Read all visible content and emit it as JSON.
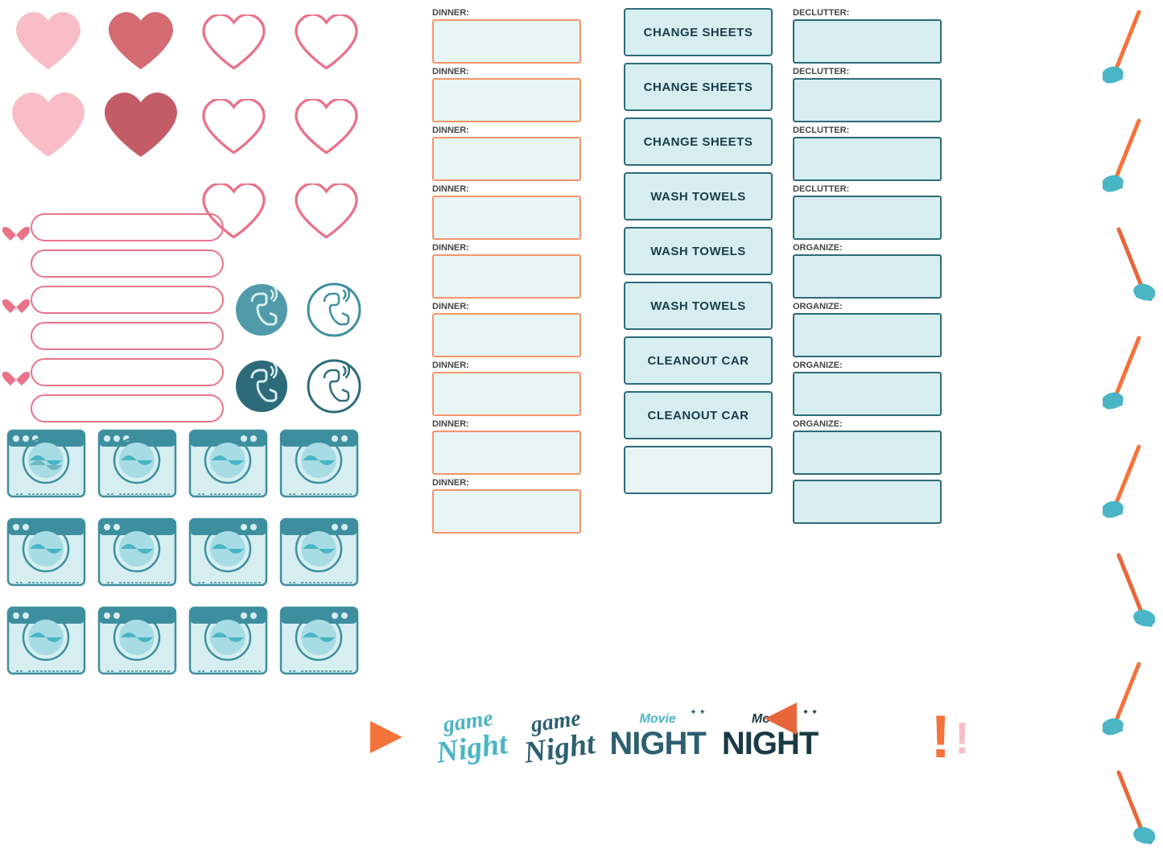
{
  "hearts": {
    "row1": [
      {
        "type": "filled",
        "color": "#f9bdc8",
        "size": "lg"
      },
      {
        "type": "filled",
        "color": "#d46b72",
        "size": "lg"
      },
      {
        "type": "outline",
        "color": "#e8738a",
        "size": "lg"
      },
      {
        "type": "outline",
        "color": "#e8738a",
        "size": "lg"
      }
    ],
    "row2": [
      {
        "type": "filled",
        "color": "#f9bdc8",
        "size": "xl"
      },
      {
        "type": "filled",
        "color": "#c45c65",
        "size": "xl"
      },
      {
        "type": "outline",
        "color": "#e8738a",
        "size": "lg"
      },
      {
        "type": "outline",
        "color": "#e8738a",
        "size": "lg"
      }
    ],
    "row3": [
      {
        "type": "none"
      },
      {
        "type": "none"
      },
      {
        "type": "outline",
        "color": "#e8738a",
        "size": "lg"
      },
      {
        "type": "outline",
        "color": "#e8738a",
        "size": "lg"
      }
    ]
  },
  "dinner_rows": [
    {
      "label": "DINNER:",
      "task": "CHANGE SHEETS",
      "right_label": "DECLUTTER:"
    },
    {
      "label": "DINNER:",
      "task": "CHANGE SHEETS",
      "right_label": "DECLUTTER:"
    },
    {
      "label": "DINNER:",
      "task": "CHANGE SHEETS",
      "right_label": "DECLUTTER:"
    },
    {
      "label": "DINNER:",
      "task": "WASH TOWELS",
      "right_label": "DECLUTTER:"
    },
    {
      "label": "DINNER:",
      "task": "WASH TOWELS",
      "right_label": "ORGANIZE:"
    },
    {
      "label": "DINNER:",
      "task": "WASH TOWELS",
      "right_label": "ORGANIZE:"
    },
    {
      "label": "DINNER:",
      "task": "CLEANOUT CAR",
      "right_label": "ORGANIZE:"
    },
    {
      "label": "DINNER:",
      "task": "CLEANOUT CAR",
      "right_label": "ORGANIZE:"
    },
    {
      "label": "DINNER:",
      "task": "",
      "right_label": ""
    }
  ],
  "banners": [
    {
      "has_heart": true
    },
    {
      "has_heart": false
    },
    {
      "has_heart": true
    },
    {
      "has_heart": false
    },
    {
      "has_heart": true
    },
    {
      "has_heart": false
    }
  ],
  "bottom": {
    "game_night_labels": [
      "game\nNight",
      "game\nNight"
    ],
    "movie_night_labels": [
      "Movie\nNIGHT",
      "Movie\nNIGHT"
    ],
    "arrows": [
      "right",
      "left"
    ]
  },
  "brooms": [
    {
      "color": "#4ab5c5",
      "handle_color": "#f4733a"
    },
    {
      "color": "#4ab5c5",
      "handle_color": "#f4733a"
    },
    {
      "color": "#4ab5c5",
      "handle_color": "#e8673a"
    },
    {
      "color": "#4ab5c5",
      "handle_color": "#f4733a"
    },
    {
      "color": "#4ab5c5",
      "handle_color": "#f4733a"
    },
    {
      "color": "#4ab5c5",
      "handle_color": "#e8673a"
    },
    {
      "color": "#4ab5c5",
      "handle_color": "#f4733a"
    },
    {
      "color": "#4ab5c5",
      "handle_color": "#e8673a"
    }
  ]
}
